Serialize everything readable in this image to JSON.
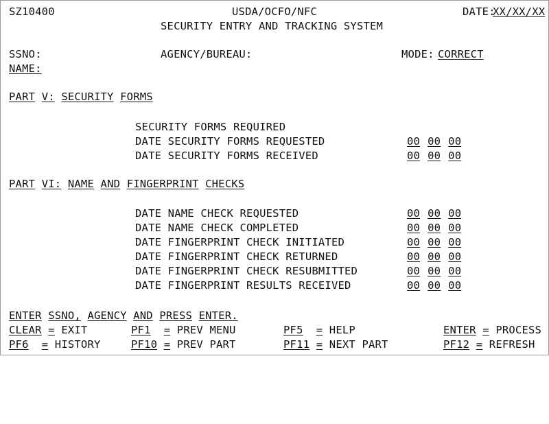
{
  "screen": {
    "screen_id": "SZ10400",
    "org_line1": "USDA/OCFO/NFC",
    "org_line2": "SECURITY ENTRY AND TRACKING SYSTEM",
    "date_label": "DATE:",
    "date_value": "XX/XX/XX"
  },
  "header_fields": {
    "ssno_label": "SSNO:",
    "ssno_value": "",
    "agency_label": "AGENCY/BUREAU:",
    "agency_value": "",
    "mode_label": "MODE:",
    "mode_value": "CORRECT",
    "name_label": "NAME:",
    "name_value": ""
  },
  "part_v": {
    "heading_words": [
      "PART",
      "V:",
      "SECURITY",
      "FORMS"
    ],
    "rows": [
      {
        "label": "SECURITY FORMS REQUIRED",
        "has_date": false,
        "date": [
          "",
          "",
          ""
        ]
      },
      {
        "label": "DATE SECURITY FORMS REQUESTED",
        "has_date": true,
        "date": [
          "00",
          "00",
          "00"
        ]
      },
      {
        "label": "DATE SECURITY FORMS RECEIVED",
        "has_date": true,
        "date": [
          "00",
          "00",
          "00"
        ]
      }
    ]
  },
  "part_vi": {
    "heading_words": [
      "PART",
      "VI:",
      "NAME",
      "AND",
      "FINGERPRINT",
      "CHECKS"
    ],
    "rows": [
      {
        "label": "DATE NAME CHECK REQUESTED",
        "has_date": true,
        "date": [
          "00",
          "00",
          "00"
        ]
      },
      {
        "label": "DATE NAME CHECK COMPLETED",
        "has_date": true,
        "date": [
          "00",
          "00",
          "00"
        ]
      },
      {
        "label": "DATE FINGERPRINT CHECK INITIATED",
        "has_date": true,
        "date": [
          "00",
          "00",
          "00"
        ]
      },
      {
        "label": "DATE FINGERPRINT CHECK RETURNED",
        "has_date": true,
        "date": [
          "00",
          "00",
          "00"
        ]
      },
      {
        "label": "DATE FINGERPRINT CHECK RESUBMITTED",
        "has_date": true,
        "date": [
          "00",
          "00",
          "00"
        ]
      },
      {
        "label": "DATE FINGERPRINT RESULTS RECEIVED",
        "has_date": true,
        "date": [
          "00",
          "00",
          "00"
        ]
      }
    ]
  },
  "footer": {
    "instruction_words": [
      "ENTER",
      "SSNO,",
      "AGENCY",
      "AND",
      "PRESS",
      "ENTER."
    ],
    "separator": "=",
    "keys": [
      {
        "key": "CLEAR",
        "action": "EXIT"
      },
      {
        "key": "PF1",
        "action": "PREV MENU"
      },
      {
        "key": "PF5",
        "action": "HELP"
      },
      {
        "key": "ENTER",
        "action": "PROCESS"
      },
      {
        "key": "PF6",
        "action": "HISTORY"
      },
      {
        "key": "PF10",
        "action": "PREV PART"
      },
      {
        "key": "PF11",
        "action": "NEXT PART"
      },
      {
        "key": "PF12",
        "action": "REFRESH"
      }
    ]
  }
}
